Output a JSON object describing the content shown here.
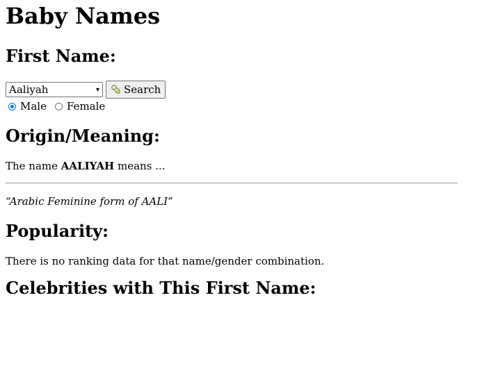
{
  "page": {
    "title": "Baby Names",
    "first_name_heading": "First Name:",
    "select": {
      "selected": "Aaliyah"
    },
    "search_button": {
      "label": "Search",
      "icon": "pacifier-icon"
    },
    "gender": {
      "options": [
        {
          "label": "Male",
          "checked": true
        },
        {
          "label": "Female",
          "checked": false
        }
      ]
    },
    "origin_heading": "Origin/Meaning:",
    "meaning": {
      "prefix": "The name",
      "name": "AALIYAH",
      "suffix": "means ..."
    },
    "quote": "“Arabic Feminine form of AALI”",
    "popularity_heading": "Popularity:",
    "ranking_text": "There is no ranking data for that name/gender combination.",
    "celebrities_heading": "Celebrities with This First Name:"
  },
  "colors": {
    "radio_accent": "#0075ff",
    "button_bg": "#efefef",
    "rule": "#9a9a9a"
  }
}
